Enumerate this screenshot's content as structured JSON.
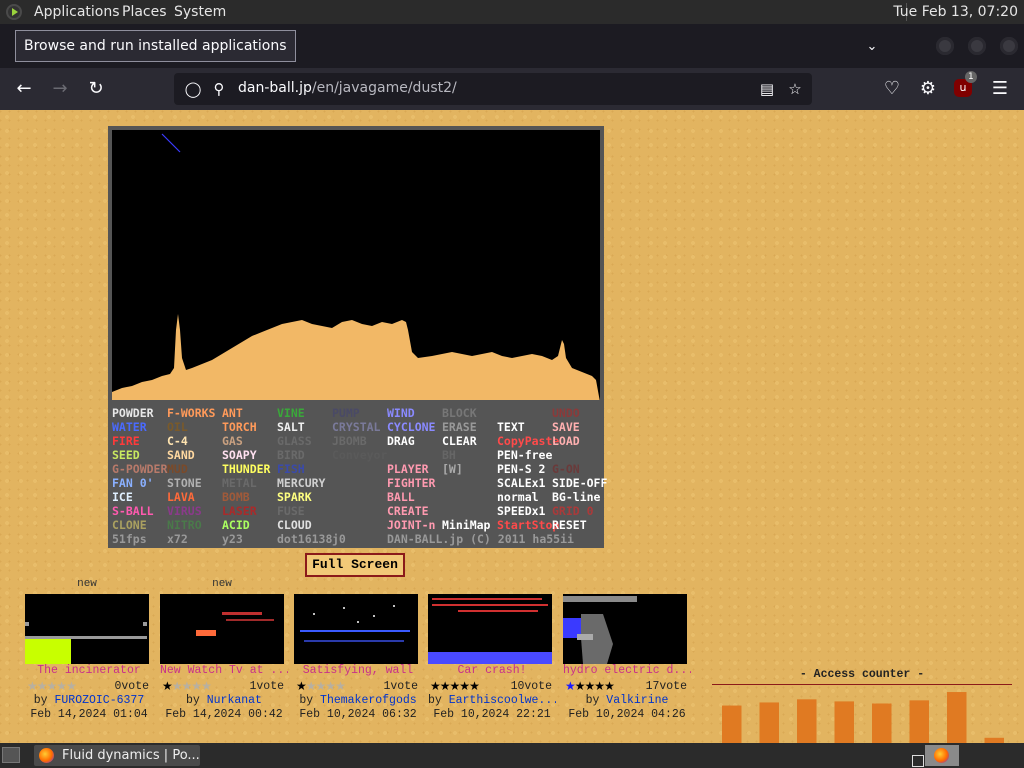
{
  "system_panel": {
    "menus": [
      "Applications",
      "Places",
      "System"
    ],
    "clock": "Tue Feb 13, 07:20"
  },
  "tooltip": "Browse and run installed applications",
  "browser": {
    "url_domain": "dan-ball.jp",
    "url_path": "/en/javagame/dust2/",
    "ublock_badge": "1"
  },
  "game": {
    "tool_rows": [
      [
        [
          "POWDER",
          "#e8e8e8"
        ],
        [
          "F-WORKS",
          "#ff9a5a"
        ],
        [
          "ANT",
          "#ff9a5a"
        ],
        [
          "VINE",
          "#3aa83a"
        ],
        [
          "PUMP",
          "#4a4a66"
        ],
        [
          "WIND",
          "#8a8aff"
        ],
        [
          "BLOCK",
          "#777777"
        ],
        [
          "",
          "#000000"
        ],
        [
          "UNDO",
          "#8b3a3a"
        ]
      ],
      [
        [
          "WATER",
          "#4a6aff"
        ],
        [
          "OIL",
          "#7a5a2a"
        ],
        [
          "TORCH",
          "#ff9a5a"
        ],
        [
          "SALT",
          "#f0f0f0"
        ],
        [
          "CRYSTAL",
          "#7a7a9a"
        ],
        [
          "CYCLONE",
          "#8a8aff"
        ],
        [
          "ERASE",
          "#999999"
        ],
        [
          "TEXT",
          "#ffffff"
        ],
        [
          "SAVE",
          "#ffb0b0"
        ]
      ],
      [
        [
          "FIRE",
          "#ff3a3a"
        ],
        [
          "C-4",
          "#ffe4b0"
        ],
        [
          "GAS",
          "#c8a080"
        ],
        [
          "GLASS",
          "#6a6a6a"
        ],
        [
          "JBOMB",
          "#6a6a6a"
        ],
        [
          "DRAG",
          "#ffffff"
        ],
        [
          "CLEAR",
          "#ffffff"
        ],
        [
          "CopyPaste",
          "#ff4a4a"
        ],
        [
          "LOAD",
          "#ffb0b0"
        ]
      ],
      [
        [
          "SEED",
          "#c8e860"
        ],
        [
          "SAND",
          "#ffd8a0"
        ],
        [
          "SOAPY",
          "#ffe0f0"
        ],
        [
          "BIRD",
          "#6a6a6a"
        ],
        [
          "Conveyor",
          "#5a5a5a"
        ],
        [
          "",
          "#000000"
        ],
        [
          "BH",
          "#666666"
        ],
        [
          "PEN-free",
          "#ffffff"
        ],
        [
          "",
          "#000000"
        ]
      ],
      [
        [
          "G-POWDER",
          "#b87a6a"
        ],
        [
          "MUD",
          "#7a4a2a"
        ],
        [
          "THUNDER",
          "#ffff60"
        ],
        [
          "FISH",
          "#3a4aaa"
        ],
        [
          "",
          "#000000"
        ],
        [
          "PLAYER",
          "#ff9ab0"
        ],
        [
          "[W]",
          "#aaaaaa"
        ],
        [
          "PEN-S 2",
          "#ffffff"
        ],
        [
          "G-ON",
          "#6a3a3a"
        ]
      ],
      [
        [
          "FAN 0'",
          "#8ab0ff"
        ],
        [
          "STONE",
          "#b0b0b0"
        ],
        [
          "METAL",
          "#6a6a6a"
        ],
        [
          "MERCURY",
          "#d0d0d0"
        ],
        [
          "",
          "#000000"
        ],
        [
          "FIGHTER",
          "#ff9ab0"
        ],
        [
          "",
          "#000000"
        ],
        [
          "SCALEx1",
          "#ffffff"
        ],
        [
          "SIDE-OFF",
          "#ffffff"
        ]
      ],
      [
        [
          "ICE",
          "#e0f0ff"
        ],
        [
          "LAVA",
          "#ff6a3a"
        ],
        [
          "BOMB",
          "#a05a3a"
        ],
        [
          "SPARK",
          "#ffff80"
        ],
        [
          "",
          "#000000"
        ],
        [
          "BALL",
          "#ff9ab0"
        ],
        [
          "",
          "#000000"
        ],
        [
          "normal",
          "#ffffff"
        ],
        [
          "BG-line",
          "#ffffff"
        ]
      ],
      [
        [
          "S-BALL",
          "#ff5ab0"
        ],
        [
          "VIRUS",
          "#8a3a8a"
        ],
        [
          "LASER",
          "#aa2a2a"
        ],
        [
          "FUSE",
          "#6a6a6a"
        ],
        [
          "",
          "#000000"
        ],
        [
          "CREATE",
          "#ff9ab0"
        ],
        [
          "",
          "#000000"
        ],
        [
          "SPEEDx1",
          "#ffffff"
        ],
        [
          "GRID 0",
          "#aa3a3a"
        ]
      ],
      [
        [
          "CLONE",
          "#aaa060"
        ],
        [
          "NITRO",
          "#4a7a4a"
        ],
        [
          "ACID",
          "#aaff60"
        ],
        [
          "CLOUD",
          "#e0e0e0"
        ],
        [
          "",
          "#000000"
        ],
        [
          "JOINT-n",
          "#ff9ab0"
        ],
        [
          "MiniMap",
          "#ffffff"
        ],
        [
          "StartStop",
          "#ff4a4a"
        ],
        [
          "RESET",
          "#ffffff"
        ]
      ],
      [
        [
          "51fps",
          "#999999"
        ],
        [
          "x72",
          "#999999"
        ],
        [
          "y23",
          "#999999"
        ],
        [
          "dot16138",
          "#999999"
        ],
        [
          "j0",
          "#999999"
        ],
        [
          "DAN-BALL.jp (C) 2011 ha55ii",
          "#999999"
        ],
        [
          "",
          "#000000"
        ],
        [
          "",
          "#000000"
        ],
        [
          "",
          "#000000"
        ]
      ]
    ],
    "fullscreen_label": "Full Screen"
  },
  "posts": [
    {
      "new": "new",
      "title": "The incinerator",
      "stars": 0,
      "votes": "0vote",
      "by": "by",
      "author": "FUROZOIC-6377",
      "date": "Feb 14,2024 01:04"
    },
    {
      "new": "new",
      "title": "New Watch Tv at ...",
      "stars": 1,
      "votes": "1vote",
      "by": "by",
      "author": "Nurkanat",
      "date": "Feb 14,2024 00:42"
    },
    {
      "new": "",
      "title": "Satisfying, wall",
      "stars": 1,
      "votes": "1vote",
      "by": "by",
      "author": "Themakerofgods",
      "date": "Feb 10,2024 06:32"
    },
    {
      "new": "",
      "title": "Car crash!",
      "stars": 5,
      "votes": "10vote",
      "by": "by",
      "author": "Earthiscoolwe...",
      "date": "Feb 10,2024 22:21"
    },
    {
      "new": "",
      "title": "hydro electric d...",
      "stars": 5,
      "votes": "17vote",
      "by": "by",
      "author": "Valkirine",
      "date": "Feb 10,2024 04:26"
    }
  ],
  "access_counter": {
    "title": "- Access counter -",
    "bar_color": "#e07a22",
    "values": [
      72,
      78,
      84,
      80,
      76,
      82,
      98,
      10
    ]
  },
  "taskbar": {
    "task_label": "Fluid dynamics | Po..."
  },
  "colors": {
    "page_bg": "#e2b460",
    "sand": "#f2b866",
    "star_filled": "#000000",
    "star_first_blue": "#1a1aff"
  }
}
